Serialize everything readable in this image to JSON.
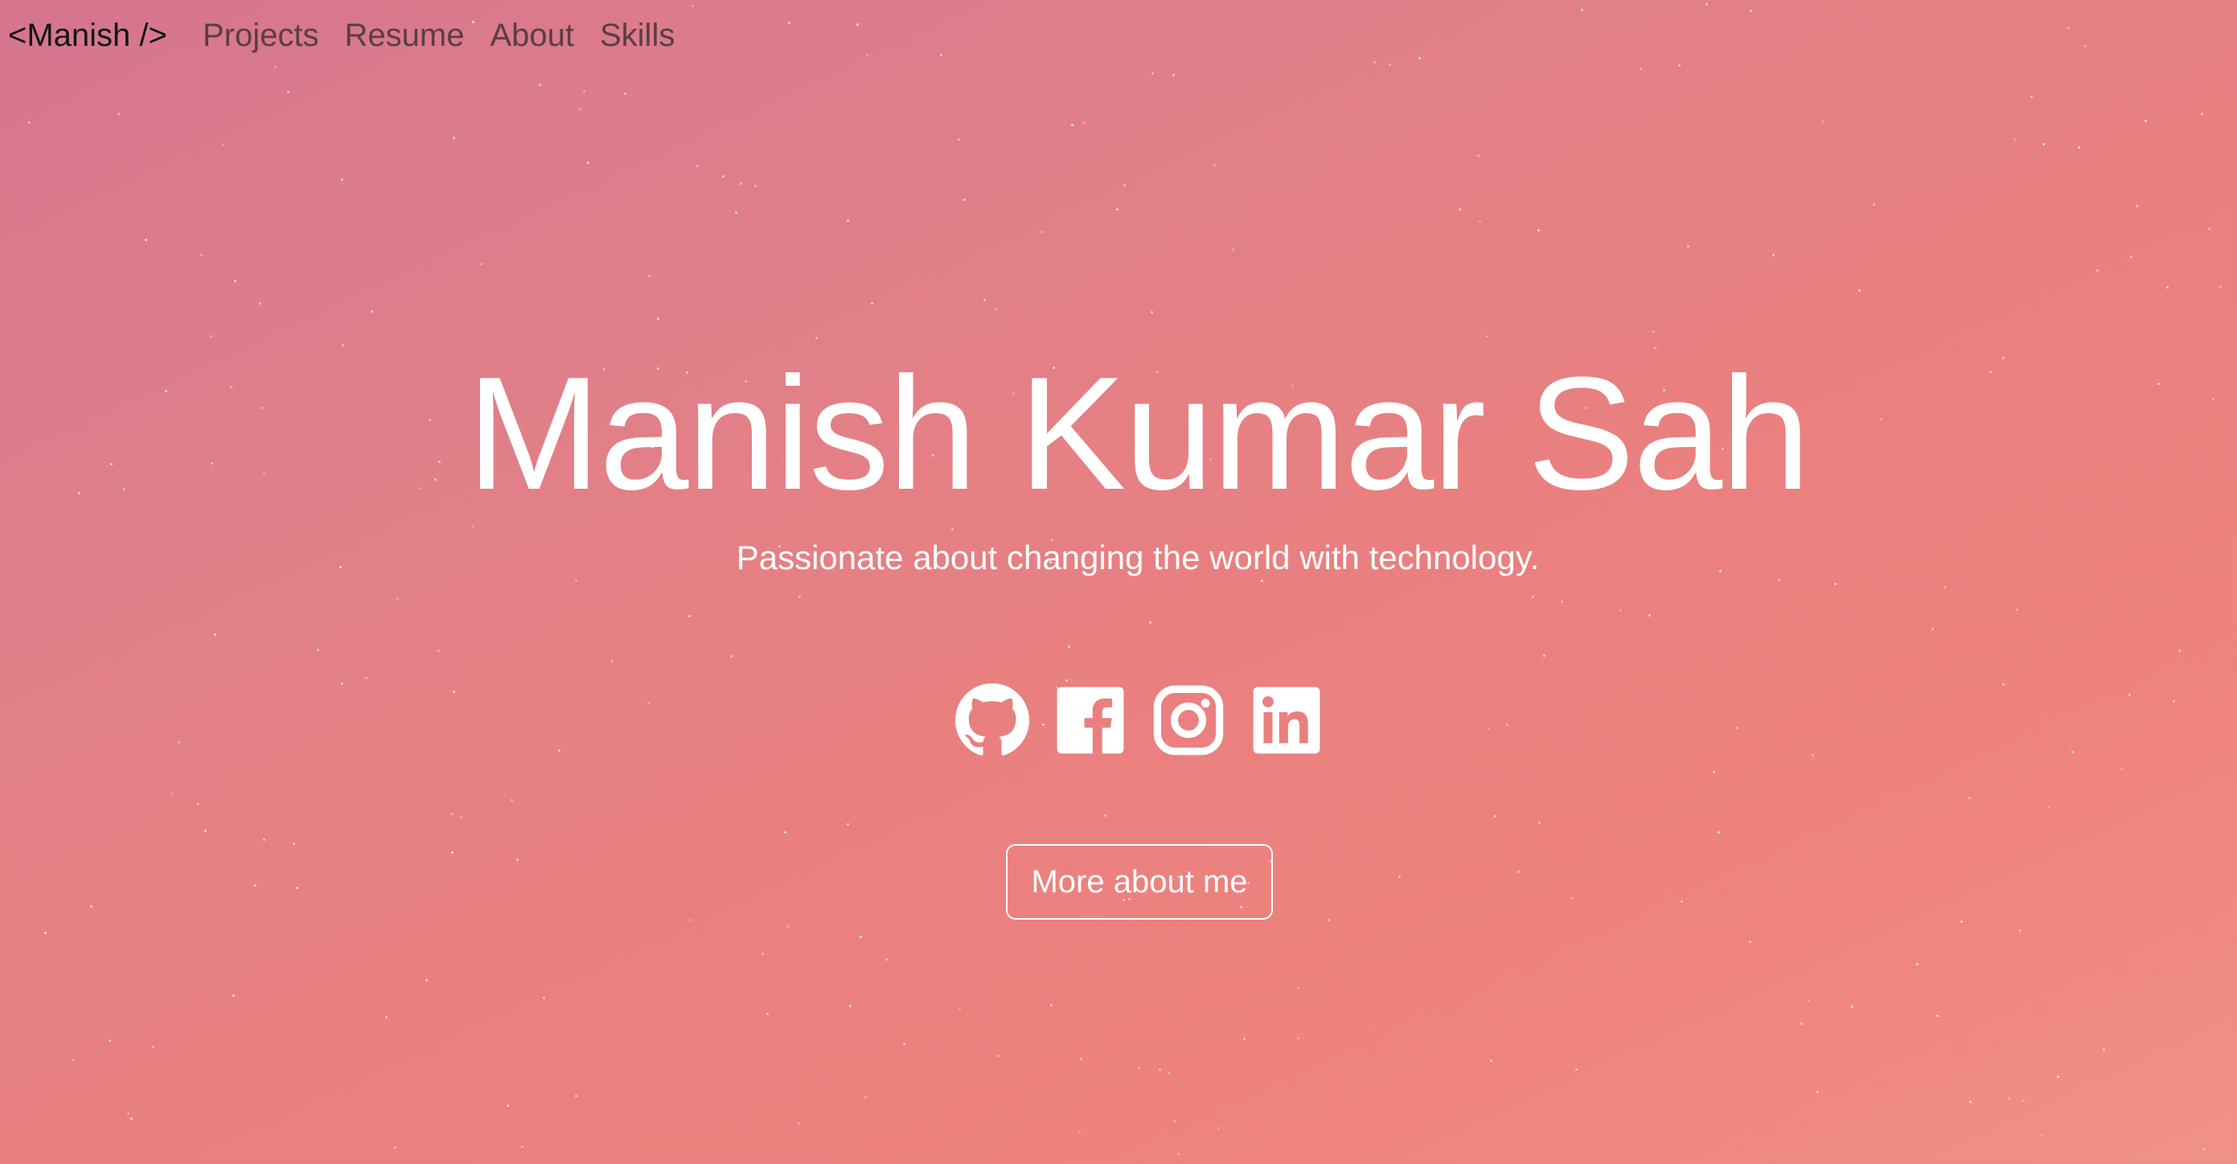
{
  "navbar": {
    "brand": "<Manish />",
    "links": [
      {
        "label": "Projects"
      },
      {
        "label": "Resume"
      },
      {
        "label": "About"
      },
      {
        "label": "Skills"
      }
    ]
  },
  "hero": {
    "title": "Manish Kumar Sah",
    "subtitle": "Passionate about changing the world with technology.",
    "socials": [
      {
        "icon": "github-icon"
      },
      {
        "icon": "facebook-icon"
      },
      {
        "icon": "instagram-icon"
      },
      {
        "icon": "linkedin-icon"
      }
    ],
    "cta_label": "More about me"
  },
  "colors": {
    "gradient_start": "#d5758e",
    "gradient_end": "#f09189",
    "text": "#ffffff",
    "brand_text": "#141414",
    "nav_text": "#5a3e44"
  }
}
